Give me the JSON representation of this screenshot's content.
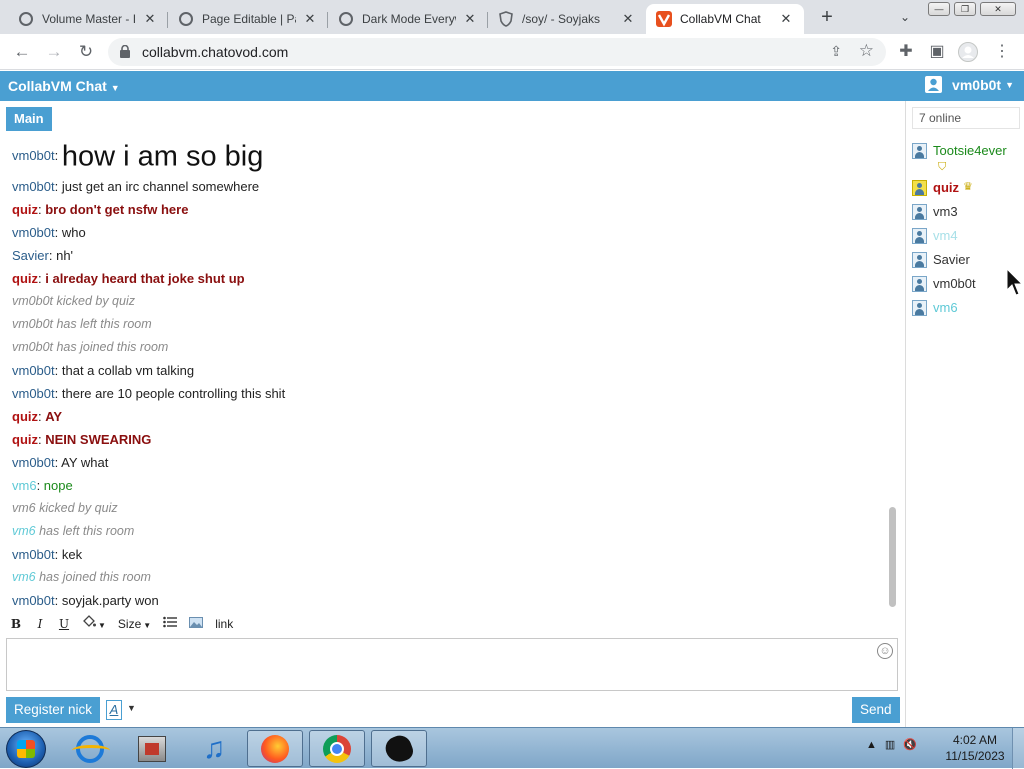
{
  "browser": {
    "tabs": [
      {
        "title": "Volume Master - I",
        "active": false
      },
      {
        "title": "Page Editable | Pa",
        "active": false
      },
      {
        "title": "Dark Mode Everyw",
        "active": false
      },
      {
        "title": "/soy/ - Soyjaks",
        "active": false
      },
      {
        "title": "CollabVM Chat",
        "active": true
      }
    ],
    "new_tab_label": "+",
    "url": "collabvm.chatovod.com"
  },
  "app": {
    "title": "CollabVM Chat",
    "current_user": "vm0b0t",
    "room_tab": "Main",
    "accent_color": "#4a9fd2"
  },
  "messages": [
    {
      "user": "vm0b0t",
      "user_type": "normal",
      "text": "how i am so big",
      "style": "huge"
    },
    {
      "user": "vm0b0t",
      "user_type": "normal",
      "text": "just get an irc channel somewhere",
      "style": "normal"
    },
    {
      "user": "quiz",
      "user_type": "admin",
      "text": "bro don't get nsfw here",
      "style": "admin"
    },
    {
      "user": "vm0b0t",
      "user_type": "normal",
      "text": "who",
      "style": "normal"
    },
    {
      "user": "Savier",
      "user_type": "normal",
      "text": "nh'",
      "style": "normal"
    },
    {
      "user": "quiz",
      "user_type": "admin",
      "text": "i alreday heard that joke shut up",
      "style": "admin"
    },
    {
      "system": "vm0b0t kicked by quiz"
    },
    {
      "system": "vm0b0t has left this room"
    },
    {
      "system": "vm0b0t has joined this room"
    },
    {
      "user": "vm0b0t",
      "user_type": "normal",
      "text": "that a collab vm talking",
      "style": "normal"
    },
    {
      "user": "vm0b0t",
      "user_type": "normal",
      "text": "there are 10 people controlling this shit",
      "style": "normal"
    },
    {
      "user": "quiz",
      "user_type": "admin",
      "text": "AY",
      "style": "admin"
    },
    {
      "user": "quiz",
      "user_type": "admin",
      "text": "NEIN SWEARING",
      "style": "admin"
    },
    {
      "user": "vm0b0t",
      "user_type": "normal",
      "text": "AY what",
      "style": "normal"
    },
    {
      "user": "vm6",
      "user_type": "guest",
      "text": "nope",
      "style": "green"
    },
    {
      "system": "vm6 kicked by quiz"
    },
    {
      "system_user": "vm6",
      "system_rest": "has left this room"
    },
    {
      "user": "vm0b0t",
      "user_type": "normal",
      "text": "kek",
      "style": "normal"
    },
    {
      "system_user": "vm6",
      "system_rest": "has joined this room"
    },
    {
      "user": "vm0b0t",
      "user_type": "normal",
      "text": "soyjak.party won",
      "style": "normal"
    }
  ],
  "formatting": {
    "bold": "B",
    "italic": "I",
    "underline": "U",
    "size": "Size",
    "link": "link"
  },
  "composer": {
    "message_value": "",
    "register_label": "Register nick",
    "font_label": "A",
    "send_label": "Send"
  },
  "sidebar": {
    "online_count": "7 online",
    "users": [
      {
        "name": "Tootsie4ever",
        "type": "green",
        "badge": "shield"
      },
      {
        "name": "quiz",
        "type": "admin",
        "badge": "crown"
      },
      {
        "name": "vm3",
        "type": "normal"
      },
      {
        "name": "vm4",
        "type": "faded"
      },
      {
        "name": "Savier",
        "type": "normal"
      },
      {
        "name": "vm0b0t",
        "type": "normal"
      },
      {
        "name": "vm6",
        "type": "guest"
      }
    ]
  },
  "taskbar": {
    "time": "4:02 AM",
    "date": "11/15/2023"
  }
}
